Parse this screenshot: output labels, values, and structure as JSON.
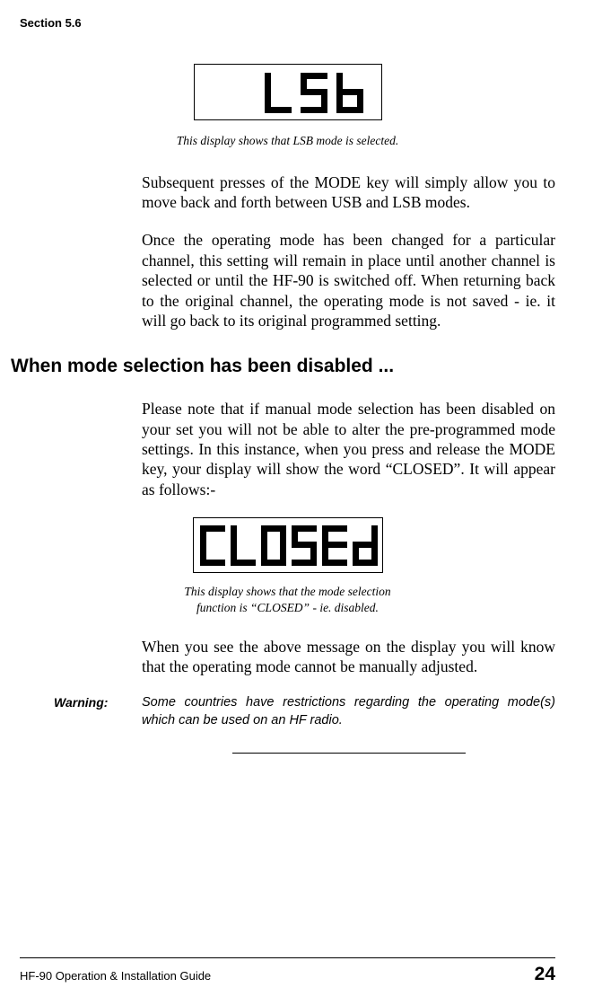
{
  "section_header": "Section 5.6",
  "lcd1_caption": "This display shows that LSB mode is selected.",
  "para1": "Subsequent presses of the MODE key will simply allow you to move back and forth between USB and LSB modes.",
  "para2": "Once the operating mode has been changed for a particular channel, this setting will remain in place until another channel is selected or until the HF-90 is switched off.  When returning back to the original channel, the operating mode is not saved - ie. it will go back to its original programmed setting.",
  "h2": "When mode selection has been disabled ...",
  "para3": "Please note that if manual mode selection has been disabled on your set you will not be able to alter the pre-programmed mode settings.  In this instance, when you press and release the MODE key, your display will show the word “CLOSED”.  It will appear as follows:-",
  "lcd2_caption": "This display shows that the mode selection function is “CLOSED” - ie. disabled.",
  "para4": "When you see the above message on the display you will know that the operating mode cannot be manually adjusted.",
  "warning_label": "Warning:",
  "warning_text": "Some countries have restrictions regarding the operating mode(s) which can be used on an HF radio.",
  "footer_title": "HF-90 Operation & Installation Guide",
  "footer_page": "24",
  "lcd1_text": "LSb",
  "lcd2_text": "CLOSEd"
}
